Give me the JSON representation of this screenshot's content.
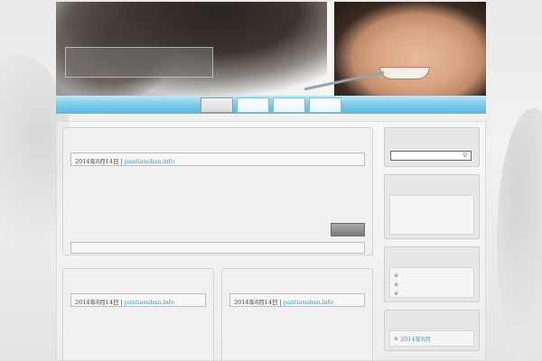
{
  "site": {
    "title": "",
    "description": ""
  },
  "nav": {
    "items": [
      {
        "label": ""
      },
      {
        "label": ""
      },
      {
        "label": ""
      },
      {
        "label": ""
      }
    ]
  },
  "posts": {
    "main": {
      "title": "",
      "meta_prefix": "",
      "date": "2014年8月14日",
      "meta_sep": " | ",
      "author_prefix": "",
      "author": "pantiasuhan.info",
      "lines": [
        "",
        "",
        "",
        "",
        ""
      ],
      "more_label": "",
      "foot_prefix": "",
      "foot_link": ""
    },
    "left": {
      "title": "",
      "meta_prefix": "",
      "date": "2014年8月14日",
      "meta_sep": " | ",
      "author_prefix": "",
      "author": "pantiasuhan.info",
      "lines": [
        "",
        "",
        "",
        ""
      ]
    },
    "right": {
      "title": "",
      "meta_prefix": "",
      "date": "2014年8月14日",
      "meta_sep": " | ",
      "author_prefix": "",
      "author": "pantiasuhan.info",
      "lines": [
        "",
        "",
        "",
        ""
      ]
    }
  },
  "sidebar": {
    "search": {
      "title": "",
      "placeholder": ""
    },
    "about": {
      "title": "",
      "text": ""
    },
    "recent": {
      "title": "",
      "items": [
        {
          "label": ""
        },
        {
          "label": ""
        },
        {
          "label": ""
        }
      ]
    },
    "archive": {
      "title": "",
      "items": [
        {
          "label": "2014年8月"
        }
      ]
    }
  }
}
